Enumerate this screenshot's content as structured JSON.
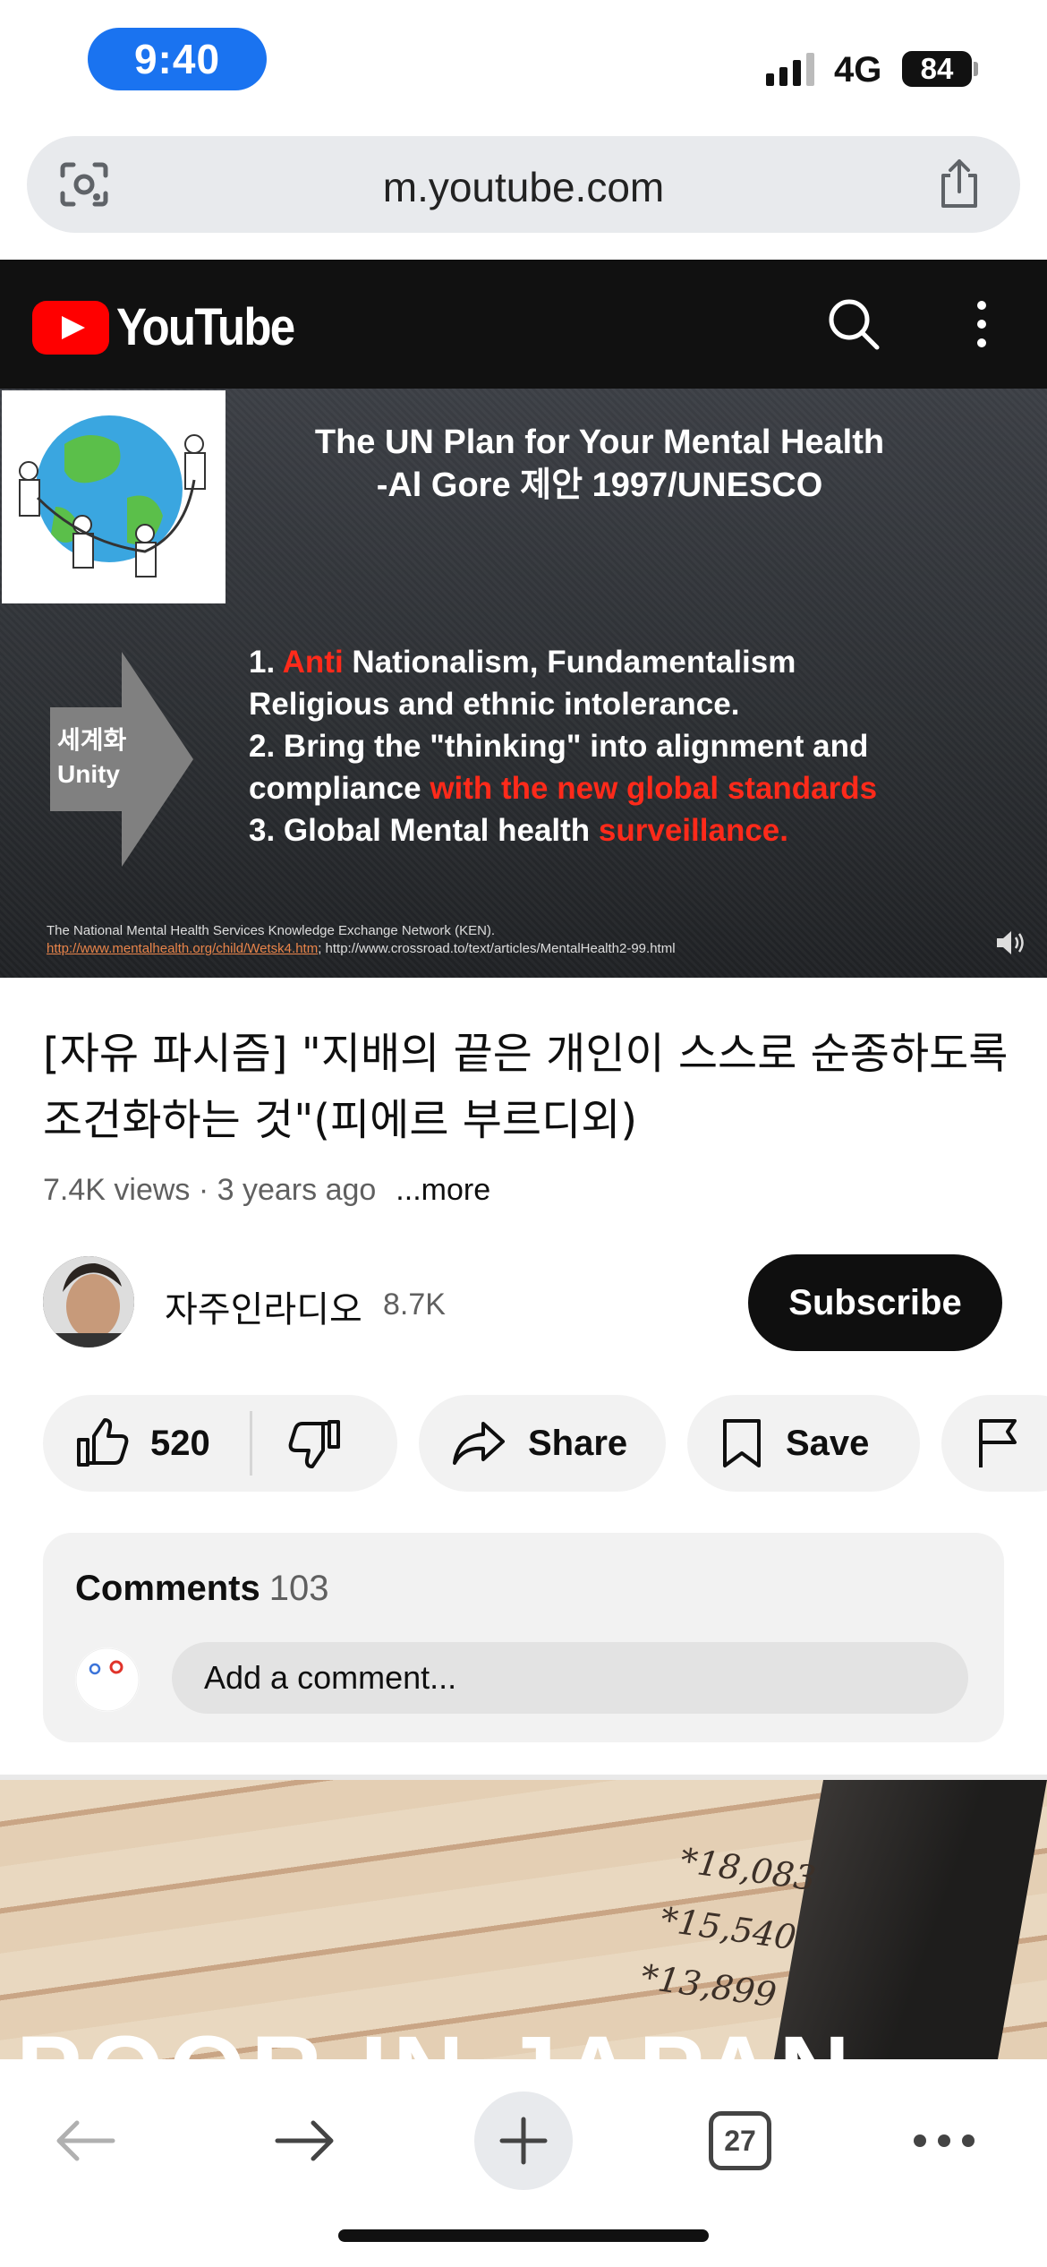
{
  "status_bar": {
    "time": "9:40",
    "network": "4G",
    "battery": "84"
  },
  "browser": {
    "url": "m.youtube.com"
  },
  "youtube": {
    "logo_text": "YouTube"
  },
  "video_slide": {
    "title_line1": "The UN Plan for Your Mental Health",
    "title_line2": "-Al Gore 제안 1997/UNESCO",
    "arrow_label_1": "세계화",
    "arrow_label_2": "Unity",
    "point1_num": "1.",
    "point1_red": "Anti",
    "point1_rest": "Nationalism, Fundamentalism",
    "point1_line2": "Religious and ethnic intolerance.",
    "point2_line1": "2. Bring the \"thinking\" into alignment and",
    "point2_white": "compliance",
    "point2_red": "with the new global standards",
    "point3_white": "3. Global Mental health",
    "point3_red": "surveillance.",
    "footer_line1": "The National Mental Health Services Knowledge Exchange Network (KEN).",
    "footer_link": "http://www.mentalhealth.org/child/Wetsk4.htm",
    "footer_rest": "; http://www.crossroad.to/text/articles/MentalHealth2-99.html"
  },
  "video": {
    "title": "[자유 파시즘] \"지배의 끝은 개인이 스스로 순종하도록 조건화하는 것\"(피에르 부르디외)",
    "meta": "7.4K views · 3 years ago",
    "more": "...more"
  },
  "channel": {
    "name": "자주인라디오",
    "subscribers": "8.7K",
    "subscribe_label": "Subscribe"
  },
  "actions": {
    "likes": "520",
    "share": "Share",
    "save": "Save"
  },
  "comments": {
    "heading": "Comments",
    "count": "103",
    "placeholder": "Add a comment..."
  },
  "next_video": {
    "title": "POOR IN JAPAN",
    "numbers": [
      "*18,083",
      "*15,540",
      "*13,899"
    ]
  },
  "toolbar": {
    "tab_count": "27"
  }
}
